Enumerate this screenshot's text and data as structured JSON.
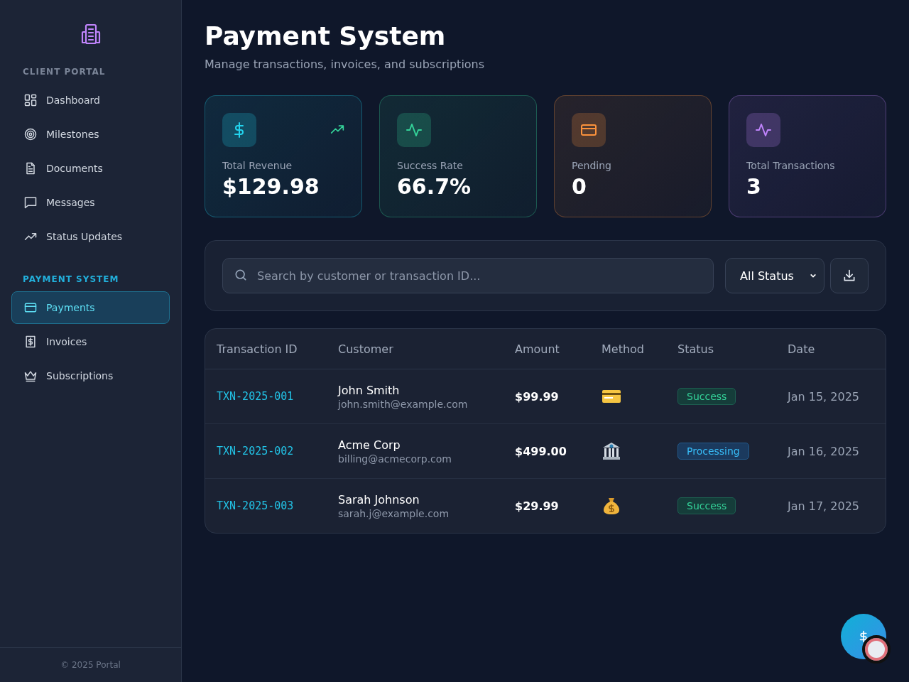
{
  "sidebar": {
    "sections": [
      {
        "title": "CLIENT PORTAL",
        "kind": "plain",
        "items": [
          {
            "label": "Dashboard",
            "kind": "grid",
            "selected": false
          },
          {
            "label": "Milestones",
            "kind": "target",
            "selected": false
          },
          {
            "label": "Documents",
            "kind": "document",
            "selected": false
          },
          {
            "label": "Messages",
            "kind": "chat",
            "selected": false
          },
          {
            "label": "Status Updates",
            "kind": "trend",
            "selected": false
          }
        ]
      },
      {
        "title": "PAYMENT SYSTEM",
        "kind": "accent",
        "items": [
          {
            "label": "Payments",
            "kind": "card",
            "selected": true
          },
          {
            "label": "Invoices",
            "kind": "receipt",
            "selected": false
          },
          {
            "label": "Subscriptions",
            "kind": "crown",
            "selected": false
          }
        ]
      }
    ],
    "footer": "© 2025 Portal"
  },
  "header": {
    "title": "Payment System",
    "subtitle": "Manage transactions, invoices, and subscriptions"
  },
  "stats": [
    {
      "label": "Total Revenue",
      "value": "$129.98",
      "kind": "dollar",
      "color": "#22d3ee",
      "trending": true
    },
    {
      "label": "Success Rate",
      "value": "66.7%",
      "kind": "pulse",
      "color": "#34d399",
      "trending": false
    },
    {
      "label": "Pending",
      "value": "0",
      "kind": "card",
      "color": "#fb923c",
      "trending": false
    },
    {
      "label": "Total Transactions",
      "value": "3",
      "kind": "pulse",
      "color": "#c084fc",
      "trending": false
    }
  ],
  "filters": {
    "search": {
      "placeholder": "Search by customer or transaction ID..."
    },
    "status_select": "All Status"
  },
  "table": {
    "columns": [
      "Transaction ID",
      "Customer",
      "Amount",
      "Method",
      "Status",
      "Date"
    ],
    "rows": [
      {
        "id": "TXN-2025-001",
        "customer": "John Smith",
        "email": "john.smith@example.com",
        "amount": "$99.99",
        "method": {
          "kind": "card"
        },
        "status": {
          "label": "Success",
          "kind": "success"
        },
        "date": "Jan 15, 2025"
      },
      {
        "id": "TXN-2025-002",
        "customer": "Acme Corp",
        "email": "billing@acmecorp.com",
        "amount": "$499.00",
        "method": {
          "kind": "bank"
        },
        "status": {
          "label": "Processing",
          "kind": "processing"
        },
        "date": "Jan 16, 2025"
      },
      {
        "id": "TXN-2025-003",
        "customer": "Sarah Johnson",
        "email": "sarah.j@example.com",
        "amount": "$29.99",
        "method": {
          "kind": "cash"
        },
        "status": {
          "label": "Success",
          "kind": "success"
        },
        "date": "Jan 17, 2025"
      }
    ]
  }
}
